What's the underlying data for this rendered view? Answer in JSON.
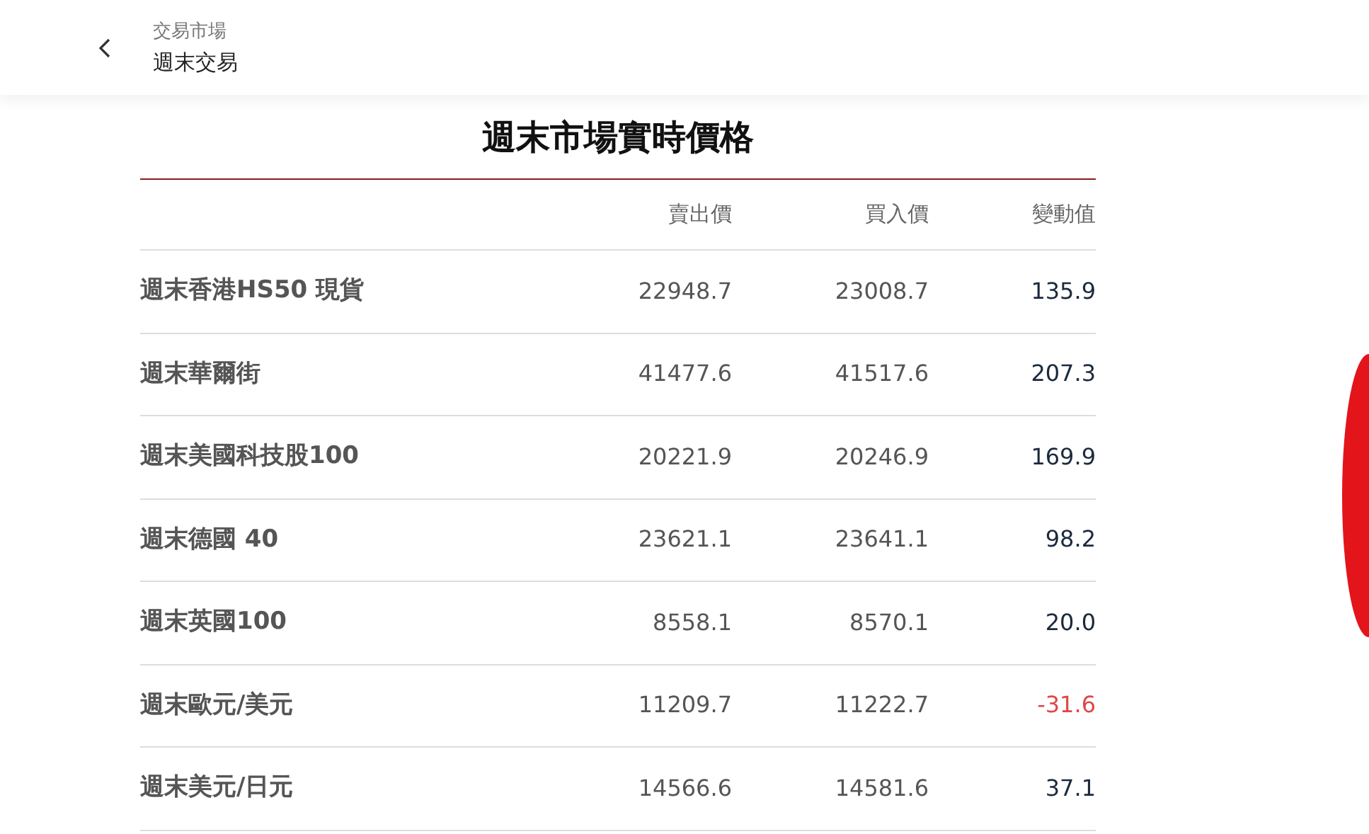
{
  "header": {
    "breadcrumb": "交易市場",
    "title": "週末交易"
  },
  "table": {
    "title": "週末市場實時價格",
    "columns": [
      "",
      "賣出價",
      "買入價",
      "變動值"
    ],
    "rows": [
      {
        "name": "週末香港HS50 現貨",
        "sell": "22948.7",
        "buy": "23008.7",
        "change": "135.9",
        "negative": false
      },
      {
        "name": "週末華爾街",
        "sell": "41477.6",
        "buy": "41517.6",
        "change": "207.3",
        "negative": false
      },
      {
        "name": "週末美國科技股100",
        "sell": "20221.9",
        "buy": "20246.9",
        "change": "169.9",
        "negative": false
      },
      {
        "name": "週末德國 40",
        "sell": "23621.1",
        "buy": "23641.1",
        "change": "98.2",
        "negative": false
      },
      {
        "name": "週末英國100",
        "sell": "8558.1",
        "buy": "8570.1",
        "change": "20.0",
        "negative": false
      },
      {
        "name": "週末歐元/美元",
        "sell": "11209.7",
        "buy": "11222.7",
        "change": "-31.6",
        "negative": true
      },
      {
        "name": "週末美元/日元",
        "sell": "14566.6",
        "buy": "14581.6",
        "change": "37.1",
        "negative": false
      }
    ]
  }
}
